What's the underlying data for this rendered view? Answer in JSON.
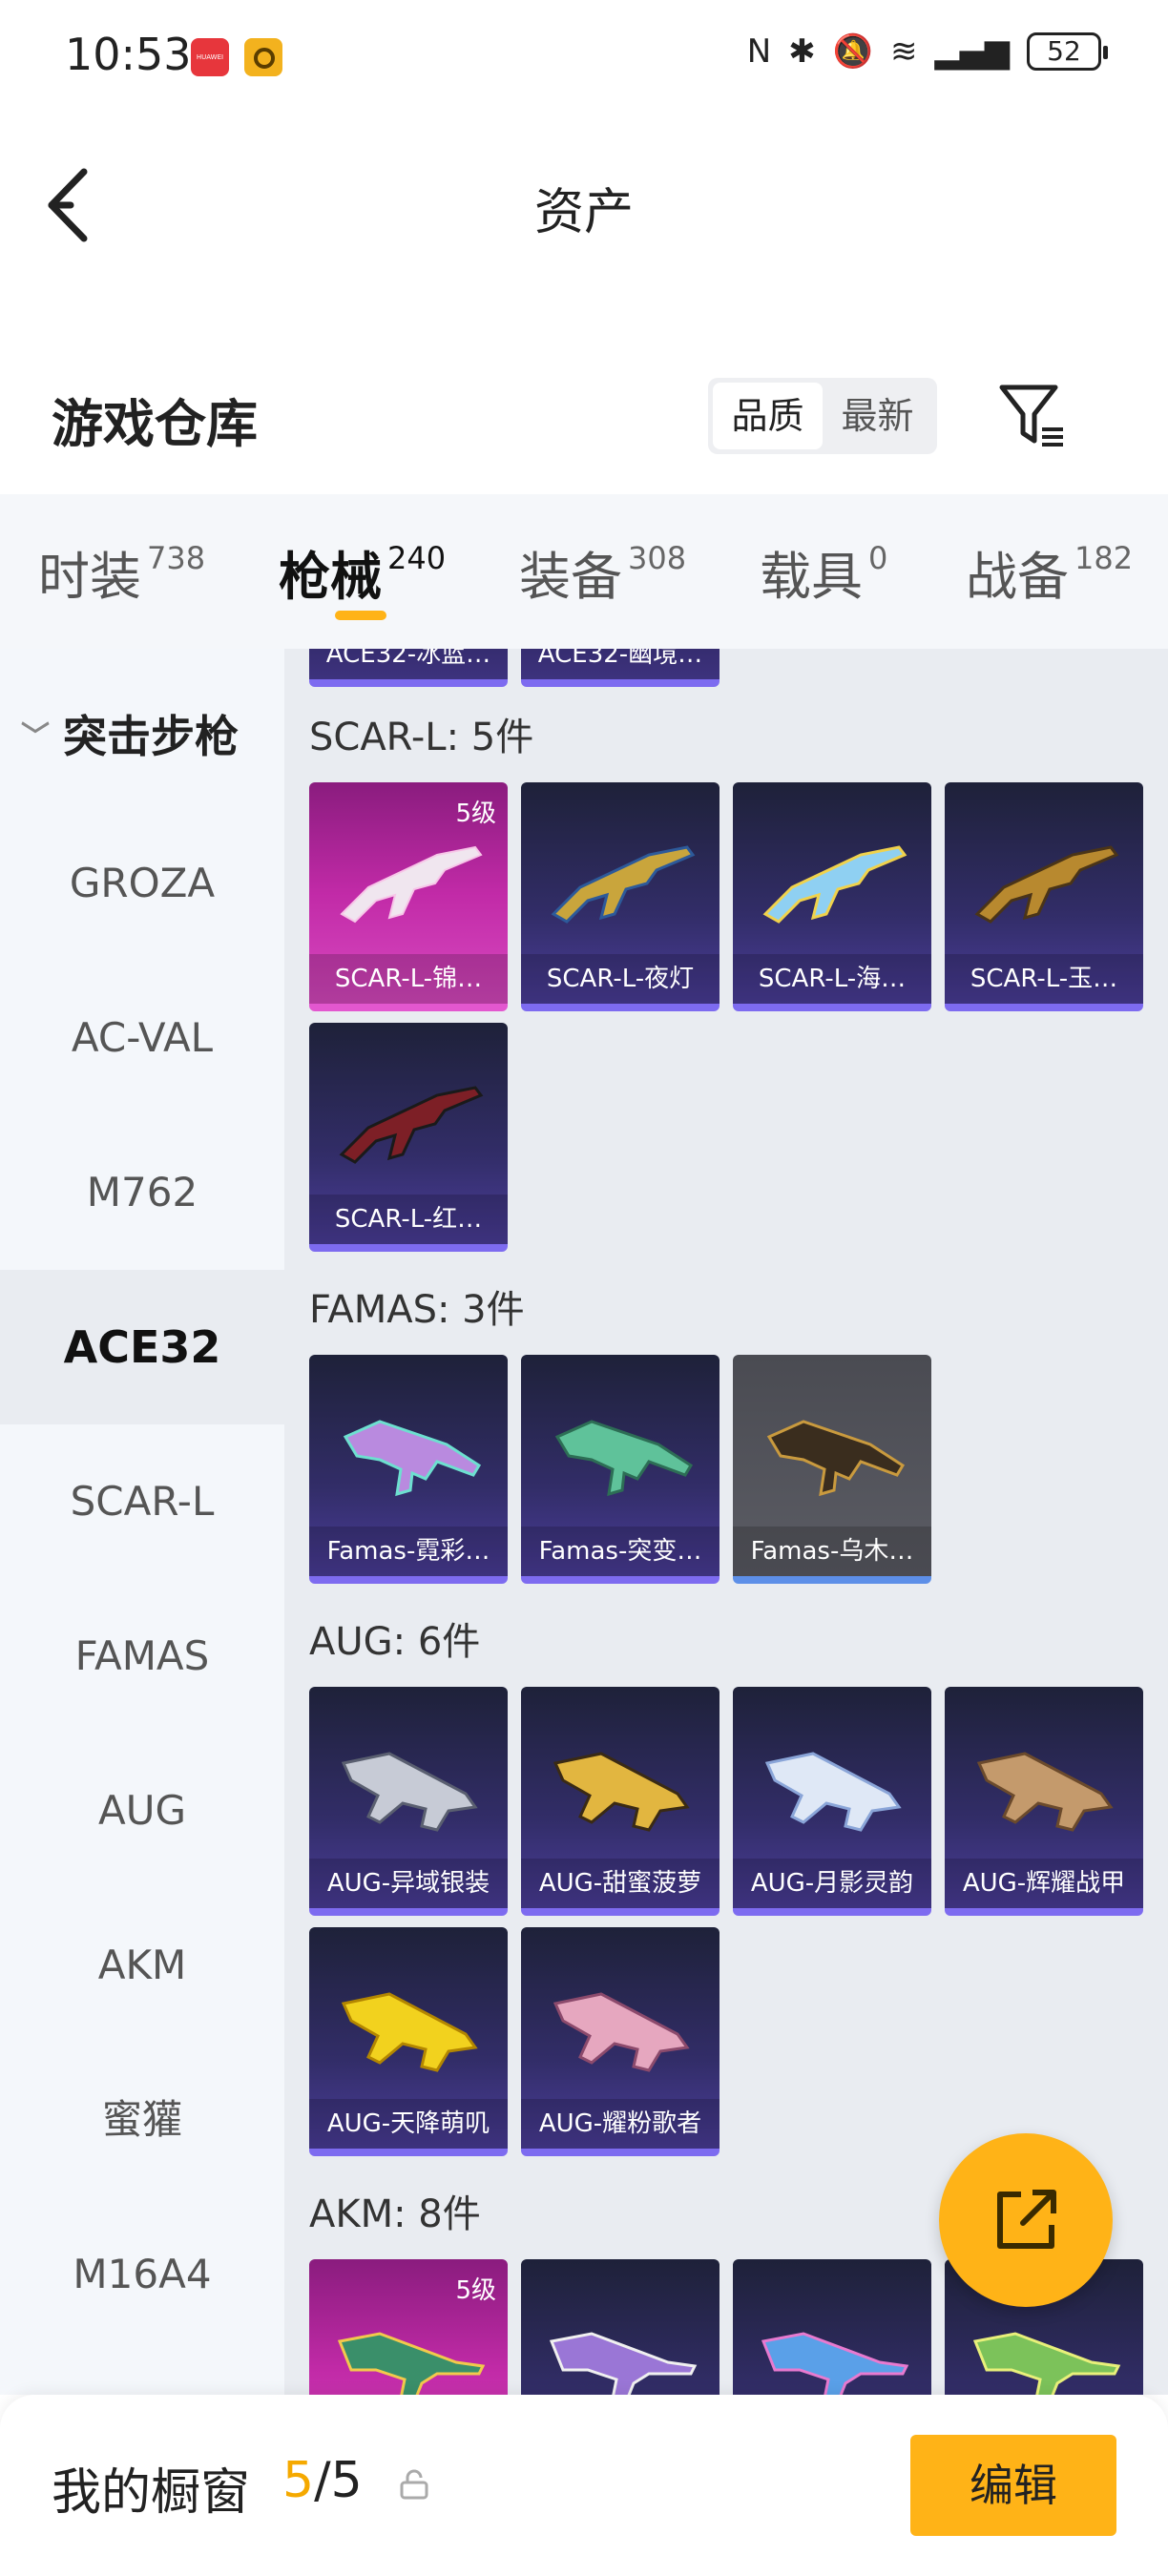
{
  "status_bar": {
    "time": "10:53",
    "app_icon_1_text": "HUAWEI",
    "battery": "52"
  },
  "header": {
    "title": "资产"
  },
  "section": {
    "title": "游戏仓库"
  },
  "sort": {
    "options": [
      "品质",
      "最新"
    ],
    "selected": "品质"
  },
  "tabs": [
    {
      "label": "时装",
      "count": "738"
    },
    {
      "label": "枪械",
      "count": "240",
      "active": true
    },
    {
      "label": "装备",
      "count": "308"
    },
    {
      "label": "载具",
      "count": "0"
    },
    {
      "label": "战备",
      "count": "182"
    }
  ],
  "sidebar": {
    "group": "突击步枪",
    "items": [
      "GROZA",
      "AC-VAL",
      "M762",
      "ACE32",
      "SCAR-L",
      "FAMAS",
      "AUG",
      "AKM",
      "蜜獾",
      "M16A4"
    ],
    "active": "ACE32"
  },
  "main": {
    "partial_top_names": [
      "ACE32-冰蓝…",
      "ACE32-幽境…"
    ],
    "groups": [
      {
        "label": "SCAR-L: 5件",
        "items": [
          {
            "name": "SCAR-L-锦…",
            "level": "5级",
            "rarity": "gold"
          },
          {
            "name": "SCAR-L-夜灯",
            "rarity": "purple"
          },
          {
            "name": "SCAR-L-海…",
            "rarity": "purple"
          },
          {
            "name": "SCAR-L-玉…",
            "rarity": "purple"
          },
          {
            "name": "SCAR-L-红…",
            "rarity": "purple"
          }
        ]
      },
      {
        "label": "FAMAS: 3件",
        "items": [
          {
            "name": "Famas-霓彩…",
            "rarity": "purple"
          },
          {
            "name": "Famas-突变…",
            "rarity": "purple"
          },
          {
            "name": "Famas-乌木…",
            "rarity": "grey"
          }
        ]
      },
      {
        "label": "AUG: 6件",
        "items": [
          {
            "name": "AUG-异域银装",
            "rarity": "purple"
          },
          {
            "name": "AUG-甜蜜菠萝",
            "rarity": "purple"
          },
          {
            "name": "AUG-月影灵韵",
            "rarity": "purple"
          },
          {
            "name": "AUG-辉耀战甲",
            "rarity": "purple"
          },
          {
            "name": "AUG-天降萌叽",
            "rarity": "purple"
          },
          {
            "name": "AUG-耀粉歌者",
            "rarity": "purple"
          }
        ]
      },
      {
        "label": "AKM: 8件",
        "items": [
          {
            "name": "",
            "level": "5级",
            "rarity": "gold"
          },
          {
            "name": "",
            "rarity": "purple"
          },
          {
            "name": "",
            "rarity": "purple"
          },
          {
            "name": "",
            "rarity": "purple"
          }
        ]
      }
    ]
  },
  "bottom_bar": {
    "label": "我的橱窗",
    "current": "5",
    "total": "5",
    "edit_label": "编辑"
  },
  "colors": {
    "accent": "#ffb317",
    "showcase_count": "#f5a900",
    "gold_card": "#c12aa7",
    "purple_card": "#4b3d9a"
  },
  "icons": [
    "back-arrow-icon",
    "filter-icon",
    "share-icon",
    "lock-icon",
    "chevron-down-icon",
    "gun-icon"
  ]
}
